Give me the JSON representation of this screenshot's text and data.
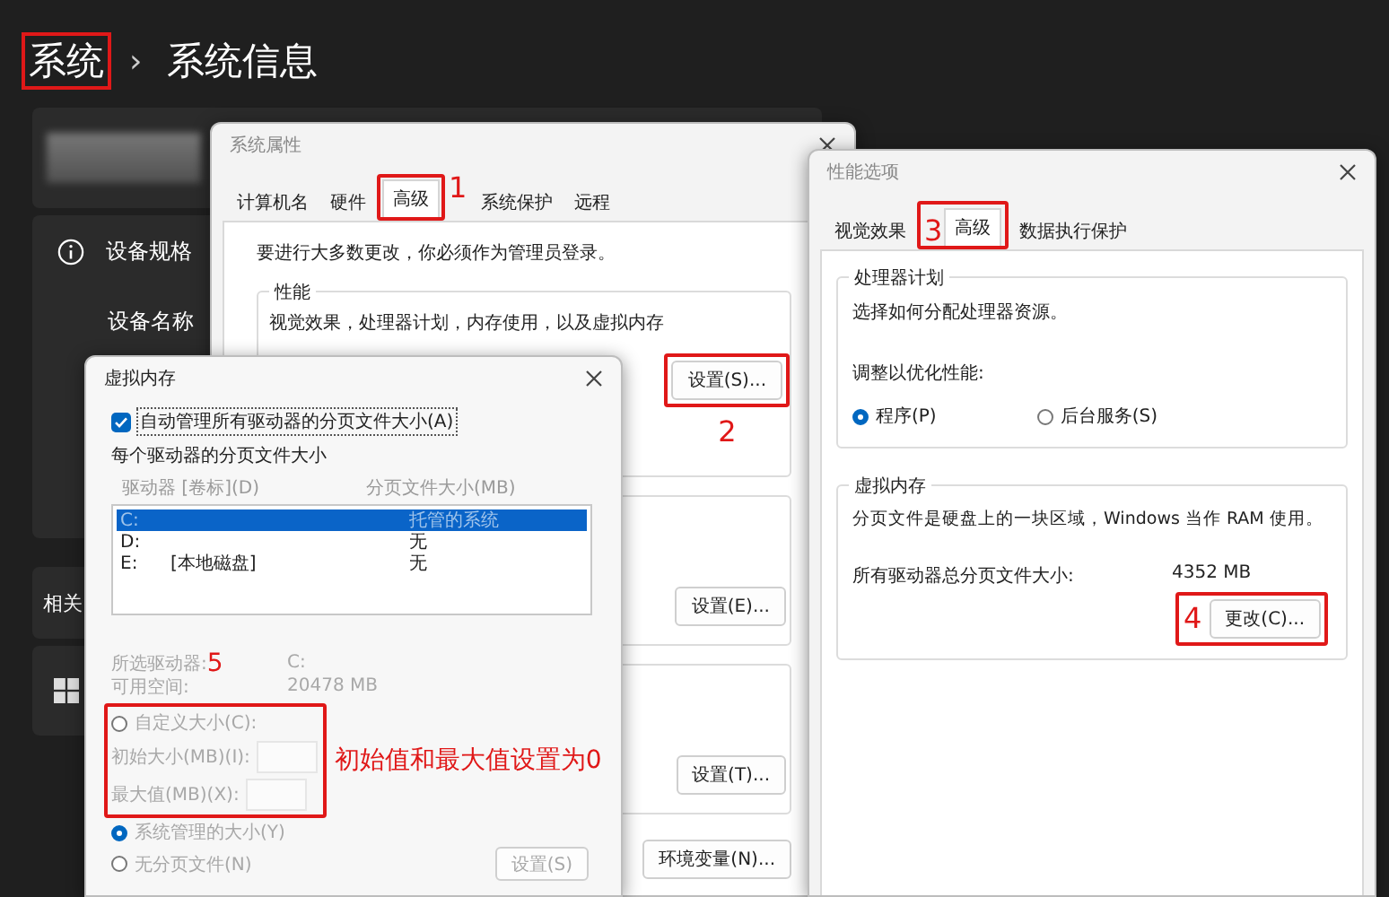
{
  "header": {
    "breadcrumb": [
      {
        "label": "系统",
        "highlighted": true
      },
      {
        "label": "系统信息",
        "highlighted": false
      }
    ],
    "separator": "›"
  },
  "sidebar": {
    "items": [
      {
        "label": "设备规格"
      },
      {
        "label": "设备名称"
      },
      {
        "label": "相关"
      }
    ]
  },
  "system_properties": {
    "title": "系统属性",
    "tabs": [
      {
        "label": "计算机名",
        "selected": false
      },
      {
        "label": "硬件",
        "selected": false
      },
      {
        "label": "高级",
        "selected": true
      },
      {
        "label": "系统保护",
        "selected": false
      },
      {
        "label": "远程",
        "selected": false
      }
    ],
    "notice": "要进行大多数更改，你必须作为管理员登录。",
    "performance": {
      "legend": "性能",
      "description": "视觉效果，处理器计划，内存使用，以及虚拟内存",
      "button": "设置(S)..."
    },
    "buttons": [
      "设置(E)...",
      "设置(T)...",
      "环境变量(N)..."
    ]
  },
  "virtual_memory": {
    "title": "虚拟内存",
    "auto_manage": {
      "label": "自动管理所有驱动器的分页文件大小(A)",
      "checked": true
    },
    "group": "每个驱动器的分页文件大小",
    "columns": [
      "驱动器 [卷标](D)",
      "分页文件大小(MB)"
    ],
    "drives": [
      {
        "drive": "C:",
        "size": "托管的系统",
        "selected": true
      },
      {
        "drive": "D:",
        "size": "无",
        "selected": false
      },
      {
        "drive": "E:",
        "label": "[本地磁盘]",
        "size": "无",
        "selected": false
      }
    ],
    "selected_drive_label": "所选驱动器:",
    "selected_drive": "C:",
    "free_space_label": "可用空间:",
    "free_space": "20478 MB",
    "disabled": true,
    "options": [
      {
        "kind": "radio",
        "label": "自定义大小(C):",
        "selected": false
      },
      {
        "kind": "field",
        "label": "初始大小(MB)(I):"
      },
      {
        "kind": "field",
        "label": "最大值(MB)(X):"
      },
      {
        "kind": "radio",
        "label": "系统管理的大小(Y)",
        "selected": true
      },
      {
        "kind": "radio",
        "label": "无分页文件(N)",
        "selected": false
      }
    ],
    "set_button": "设置(S)"
  },
  "performance_options": {
    "title": "性能选项",
    "tabs": [
      {
        "label": "视觉效果",
        "selected": false
      },
      {
        "label": "高级",
        "selected": true
      },
      {
        "label": "数据执行保护",
        "selected": false
      }
    ],
    "processor": {
      "legend": "处理器计划",
      "description": "选择如何分配处理器资源。",
      "adjust_label": "调整以优化性能:",
      "choices": [
        {
          "label": "程序(P)",
          "selected": true
        },
        {
          "label": "后台服务(S)",
          "selected": false
        }
      ]
    },
    "virtual_memory": {
      "legend": "虚拟内存",
      "description": "分页文件是硬盘上的一块区域，Windows 当作 RAM 使用。",
      "total_label": "所有驱动器总分页文件大小:",
      "total": "4352 MB",
      "button": "更改(C)..."
    }
  },
  "annotations": {
    "steps": [
      "1",
      "2",
      "3",
      "4",
      "5"
    ],
    "note": "初始值和最大值设置为0"
  }
}
